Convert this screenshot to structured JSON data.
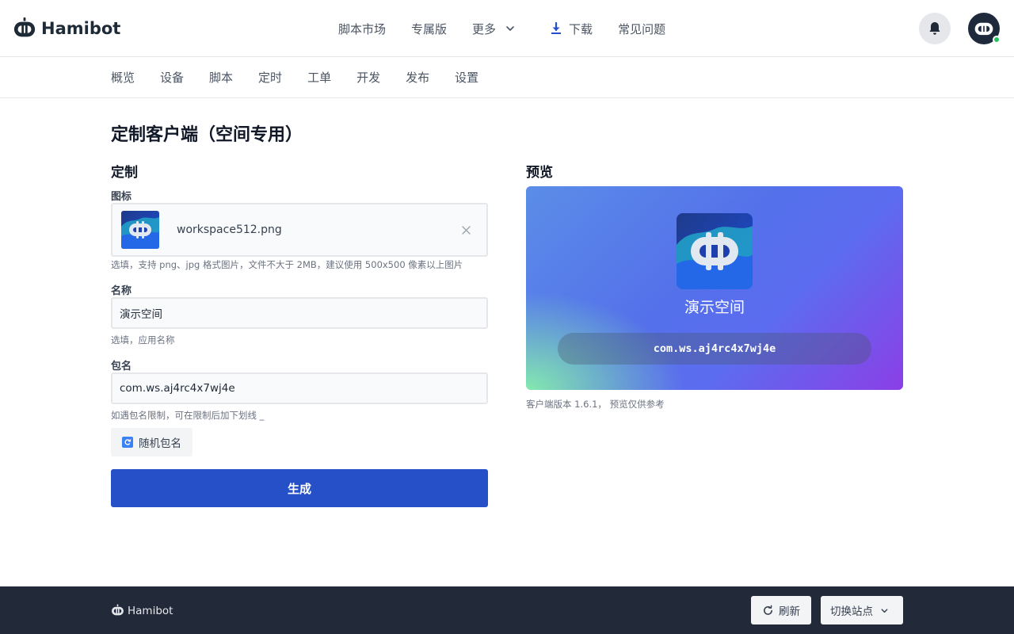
{
  "brand": {
    "name": "Hamibot"
  },
  "top_nav": {
    "items": [
      {
        "label": "脚本市场"
      },
      {
        "label": "专属版"
      },
      {
        "label": "更多",
        "icon": "chevron-down-icon"
      },
      {
        "label": "下载",
        "icon": "download-icon"
      },
      {
        "label": "常见问题"
      }
    ]
  },
  "header_icons": [
    "bell-icon",
    "hamibot-avatar"
  ],
  "sub_nav": {
    "items": [
      {
        "label": "概览"
      },
      {
        "label": "设备"
      },
      {
        "label": "脚本"
      },
      {
        "label": "定时"
      },
      {
        "label": "工单"
      },
      {
        "label": "开发"
      },
      {
        "label": "发布"
      },
      {
        "label": "设置"
      }
    ]
  },
  "page": {
    "title": "定制客户端（空间专用）"
  },
  "customize": {
    "section_title": "定制",
    "icon_field": {
      "label": "图标",
      "file_name": "workspace512.png",
      "hint": "选填，支持 png、jpg 格式图片，文件不大于 2MB，建议使用 500x500 像素以上图片"
    },
    "name_field": {
      "label": "名称",
      "value": "演示空间",
      "hint": "选填，应用名称"
    },
    "package_field": {
      "label": "包名",
      "value": "com.ws.aj4rc4x7wj4e",
      "hint": "如遇包名限制，可在限制后加下划线 _"
    },
    "random_button": {
      "label": "随机包名"
    },
    "generate_button": {
      "label": "生成"
    }
  },
  "preview": {
    "section_title": "预览",
    "app_name": "演示空间",
    "package_name": "com.ws.aj4rc4x7wj4e",
    "note": "客户端版本 1.6.1， 预览仅供参考"
  },
  "footer": {
    "brand": "Hamibot",
    "refresh_label": "刷新",
    "switch_site_label": "切换站点"
  },
  "colors": {
    "primary": "#2650c8",
    "footer_bg": "#222a3a",
    "online_status": "#22c55e",
    "preview_gradient_start": "#86efac",
    "preview_gradient_end": "#8b3fe6"
  }
}
